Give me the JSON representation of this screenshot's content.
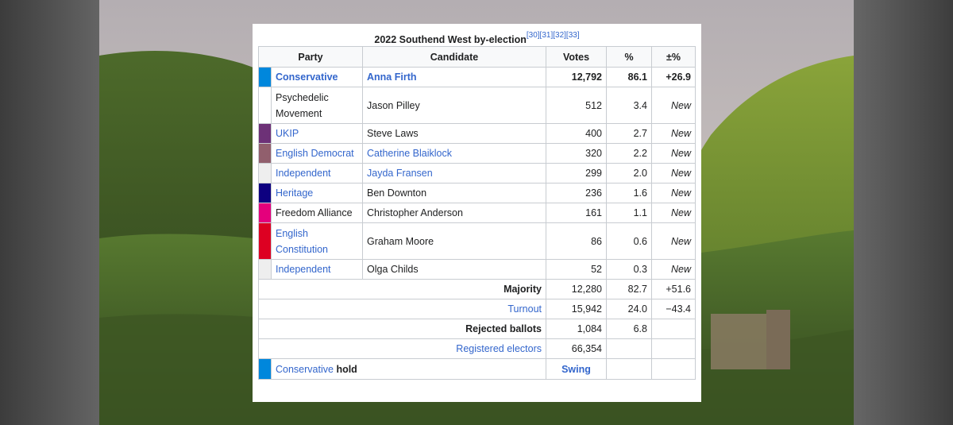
{
  "caption": {
    "title": "2022 Southend West by-election",
    "refs": "[30][31][32][33]"
  },
  "headers": [
    "Party",
    "Candidate",
    "Votes",
    "%",
    "±%"
  ],
  "rows": [
    {
      "color": "#0087dc",
      "party": "Conservative",
      "party_link": true,
      "candidate": "Anna Firth",
      "candidate_link": true,
      "votes": "12,792",
      "pct": "86.1",
      "change": "+26.9",
      "bold": true
    },
    {
      "color": "#ffffff",
      "party": "Psychedelic Movement",
      "party_link": false,
      "candidate": "Jason Pilley",
      "candidate_link": false,
      "votes": "512",
      "pct": "3.4",
      "change": "New",
      "bold": false
    },
    {
      "color": "#6d3177",
      "party": "UKIP",
      "party_link": true,
      "candidate": "Steve Laws",
      "candidate_link": false,
      "votes": "400",
      "pct": "2.7",
      "change": "New",
      "bold": false
    },
    {
      "color": "#915f6d",
      "party": "English Democrat",
      "party_link": true,
      "candidate": "Catherine Blaiklock",
      "candidate_link": true,
      "votes": "320",
      "pct": "2.2",
      "change": "New",
      "bold": false
    },
    {
      "color": "#eeeeee",
      "party": "Independent",
      "party_link": true,
      "candidate": "Jayda Fransen",
      "candidate_link": true,
      "votes": "299",
      "pct": "2.0",
      "change": "New",
      "bold": false
    },
    {
      "color": "#0d0080",
      "party": "Heritage",
      "party_link": true,
      "candidate": "Ben Downton",
      "candidate_link": false,
      "votes": "236",
      "pct": "1.6",
      "change": "New",
      "bold": false
    },
    {
      "color": "#e4007c",
      "party": "Freedom Alliance",
      "party_link": false,
      "candidate": "Christopher Anderson",
      "candidate_link": false,
      "votes": "161",
      "pct": "1.1",
      "change": "New",
      "bold": false
    },
    {
      "color": "#dd0022",
      "party": "English Constitution",
      "party_link": true,
      "candidate": "Graham Moore",
      "candidate_link": false,
      "votes": "86",
      "pct": "0.6",
      "change": "New",
      "bold": false
    },
    {
      "color": "#eeeeee",
      "party": "Independent",
      "party_link": true,
      "candidate": "Olga Childs",
      "candidate_link": false,
      "votes": "52",
      "pct": "0.3",
      "change": "New",
      "bold": false
    }
  ],
  "summary": {
    "majority": {
      "label": "Majority",
      "votes": "12,280",
      "pct": "82.7",
      "change": "+51.6"
    },
    "turnout": {
      "label": "Turnout",
      "votes": "15,942",
      "pct": "24.0",
      "change": "−43.4"
    },
    "rejected": {
      "label": "Rejected ballots",
      "votes": "1,084",
      "pct": "6.8"
    },
    "registered": {
      "label": "Registered electors",
      "votes": "66,354"
    }
  },
  "result": {
    "color": "#0087dc",
    "party": "Conservative",
    "word": "hold",
    "swing": "Swing"
  }
}
